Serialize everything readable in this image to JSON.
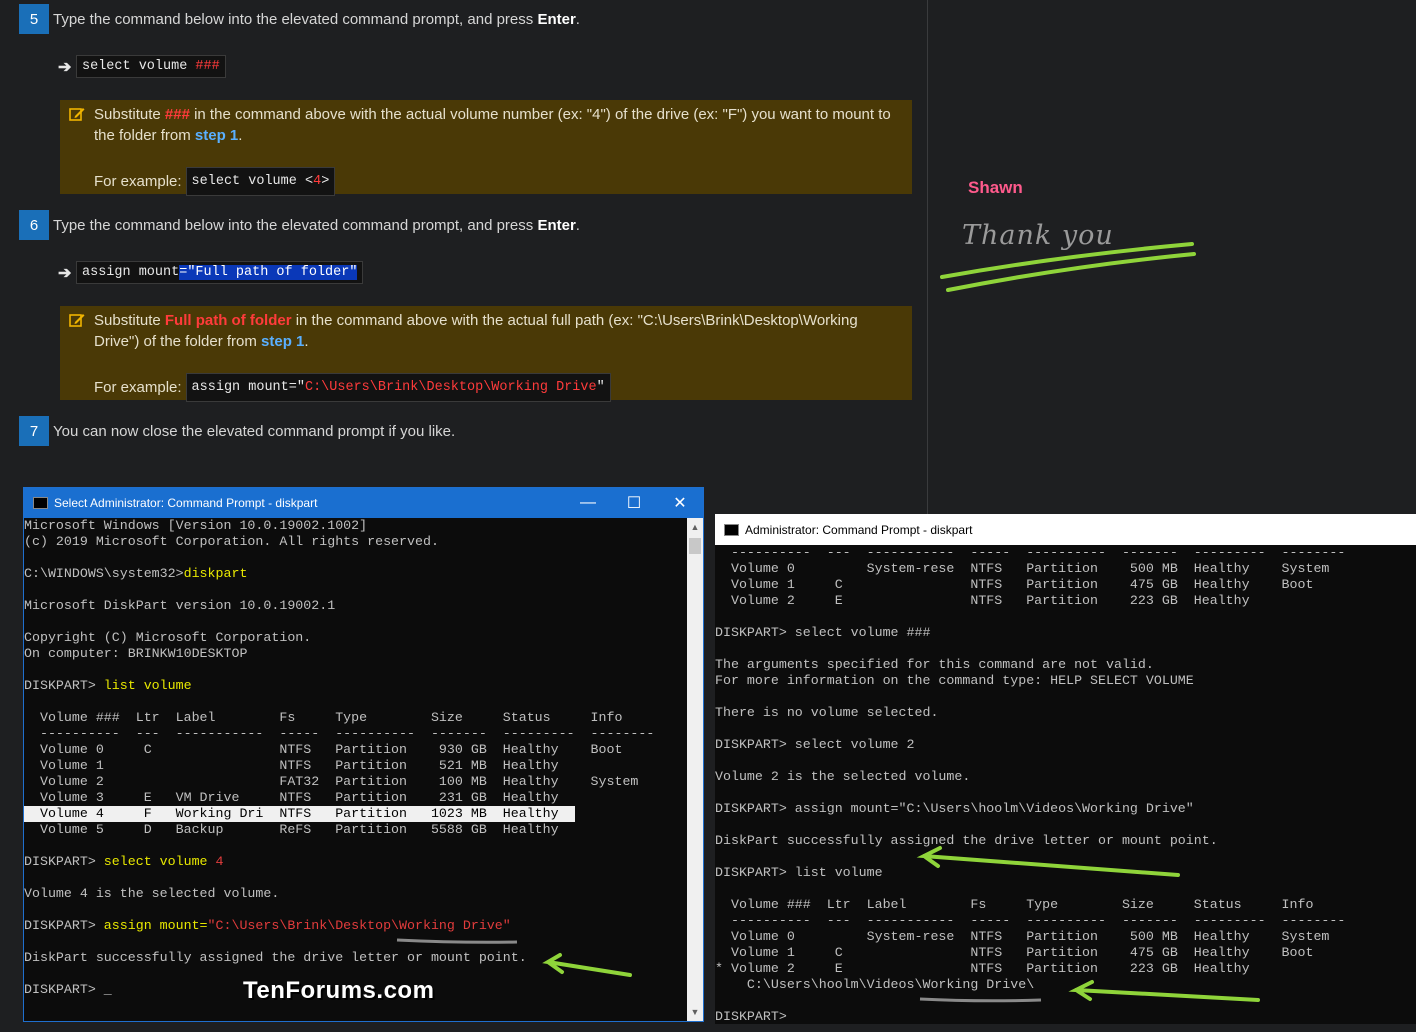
{
  "steps": [
    {
      "num": "5",
      "text": "Type the command below into the elevated command prompt, and press ",
      "bold": "Enter",
      "end": "."
    },
    {
      "num": "6",
      "text": "Type the command below into the elevated command prompt, and press ",
      "bold": "Enter",
      "end": "."
    },
    {
      "num": "7",
      "text": "You can now close the elevated command prompt if you like."
    }
  ],
  "cmd1": {
    "prefix": "select volume ",
    "var": "###"
  },
  "note1": {
    "a": "Substitute ",
    "var": "###",
    "b": " in the command above with the actual volume number (ex: \"4\") of the drive (ex: \"F\") you want to mount to the folder from ",
    "link": "step 1",
    "c": ".",
    "ex_label": "For example:",
    "ex_prefix": "select volume <",
    "ex_var": "4",
    "ex_suffix": ">"
  },
  "cmd2": {
    "prefix": "assign mount",
    "sel": "=\"Full path of folder\""
  },
  "note2": {
    "a": "Substitute ",
    "var": "Full path of folder",
    "b": " in the command above with the actual full path (ex: \"C:\\Users\\Brink\\Desktop\\Working Drive\") of the folder from ",
    "link": "step 1",
    "c": ".",
    "ex_label": "For example:",
    "ex_prefix": "assign mount=\"",
    "ex_var": "C:\\Users\\Brink\\Desktop\\Working Drive",
    "ex_suffix": "\""
  },
  "comment": {
    "author": "Shawn",
    "text": "Thank you"
  },
  "win1": {
    "title": "Select Administrator: Command Prompt - diskpart",
    "lines": [
      "Microsoft Windows [Version 10.0.19002.1002]",
      "(c) 2019 Microsoft Corporation. All rights reserved.",
      "",
      "C:\\WINDOWS\\system32>",
      "",
      "Microsoft DiskPart version 10.0.19002.1",
      "",
      "Copyright (C) Microsoft Corporation.",
      "On computer: BRINKW10DESKTOP",
      "",
      "DISKPART> ",
      "",
      "  Volume ###  Ltr  Label        Fs     Type        Size     Status     Info",
      "  ----------  ---  -----------  -----  ----------  -------  ---------  --------",
      "  Volume 0     C                NTFS   Partition    930 GB  Healthy    Boot",
      "  Volume 1                      NTFS   Partition    521 MB  Healthy",
      "  Volume 2                      FAT32  Partition    100 MB  Healthy    System",
      "  Volume 3     E   VM Drive     NTFS   Partition    231 GB  Healthy",
      "  Volume 4     F   Working Dri  NTFS   Partition   1023 MB  Healthy  ",
      "  Volume 5     D   Backup       ReFS   Partition   5588 GB  Healthy",
      "",
      "DISKPART> ",
      "",
      "Volume 4 is the selected volume.",
      "",
      "DISKPART> ",
      "",
      "DiskPart successfully assigned the drive letter or mount point.",
      "",
      "DISKPART> _"
    ],
    "cmd_diskpart": "diskpart",
    "cmd_list": "list volume",
    "cmd_select": "select volume ",
    "cmd_select_num": "4",
    "cmd_assign": "assign mount=",
    "cmd_assign_path": "\"C:\\Users\\Brink\\Desktop\\Working Drive\""
  },
  "win2": {
    "title": "Administrator: Command Prompt - diskpart",
    "lines": [
      "  ----------  ---  -----------  -----  ----------  -------  ---------  --------",
      "  Volume 0         System-rese  NTFS   Partition    500 MB  Healthy    System",
      "  Volume 1     C                NTFS   Partition    475 GB  Healthy    Boot",
      "  Volume 2     E                NTFS   Partition    223 GB  Healthy",
      "",
      "DISKPART> select volume ###",
      "",
      "The arguments specified for this command are not valid.",
      "For more information on the command type: HELP SELECT VOLUME",
      "",
      "There is no volume selected.",
      "",
      "DISKPART> select volume 2",
      "",
      "Volume 2 is the selected volume.",
      "",
      "DISKPART> assign mount=\"C:\\Users\\hoolm\\Videos\\Working Drive\"",
      "",
      "DiskPart successfully assigned the drive letter or mount point.",
      "",
      "DISKPART> list volume",
      "",
      "  Volume ###  Ltr  Label        Fs     Type        Size     Status     Info",
      "  ----------  ---  -----------  -----  ----------  -------  ---------  --------",
      "  Volume 0         System-rese  NTFS   Partition    500 MB  Healthy    System",
      "  Volume 1     C                NTFS   Partition    475 GB  Healthy    Boot",
      "* Volume 2     E                NTFS   Partition    223 GB  Healthy",
      "    C:\\Users\\hoolm\\Videos\\Working Drive\\",
      "",
      "DISKPART>"
    ]
  },
  "brand": "TenForums.com",
  "colors": {
    "accent": "#1a6fb8",
    "note_bg": "#4a3906",
    "arrow_green": "#8fd43a"
  }
}
